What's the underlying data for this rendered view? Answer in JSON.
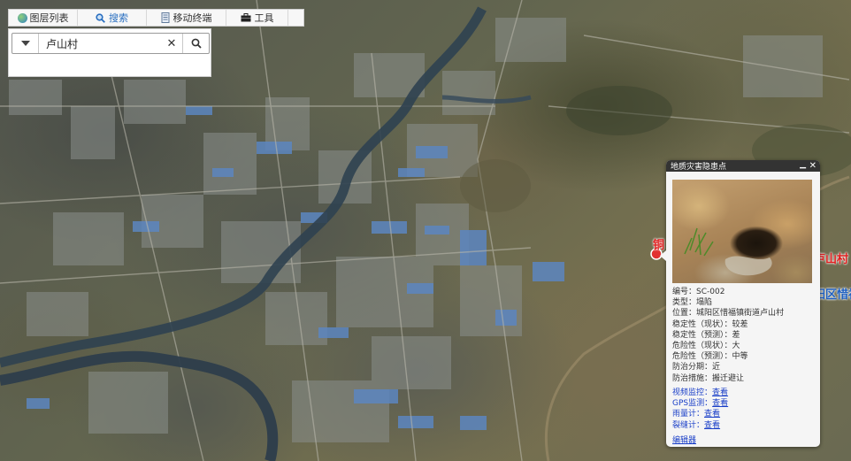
{
  "toolbar": {
    "items": [
      {
        "label": "图层列表",
        "icon": "layers-icon",
        "color": "#3a8a3a"
      },
      {
        "label": "搜索",
        "icon": "search-icon",
        "color": "#2a6fc0"
      },
      {
        "label": "移动终端",
        "icon": "mobile-doc-icon",
        "color": "#555555"
      },
      {
        "label": "工具",
        "icon": "toolbox-icon",
        "color": "#222222"
      }
    ]
  },
  "search": {
    "value": "卢山村",
    "clear_glyph": "✕",
    "search_glyph": "⌕"
  },
  "popup": {
    "title": "地质灾害隐患点",
    "minimize_glyph": "▁",
    "close_glyph": "✕",
    "photo_icon": "cave-photo",
    "fields": [
      {
        "label": "编号",
        "value": "SC-002"
      },
      {
        "label": "类型",
        "value": "塌陷"
      },
      {
        "label": "位置",
        "value": "城阳区惜福镇街道卢山村"
      },
      {
        "label": "稳定性（现状）",
        "value": "较差"
      },
      {
        "label": "稳定性（预测）",
        "value": "差"
      },
      {
        "label": "危险性（现状）",
        "value": "大"
      },
      {
        "label": "危险性（预测）",
        "value": "中等"
      },
      {
        "label": "防治分期",
        "value": "近"
      },
      {
        "label": "防治措施",
        "value": "搬迁避让"
      }
    ],
    "links": [
      {
        "label": "视频监控",
        "value": "查看"
      },
      {
        "label": "GPS监测",
        "value": "查看"
      },
      {
        "label": "雨量计",
        "value": "查看"
      },
      {
        "label": "裂缝计",
        "value": "查看"
      }
    ],
    "edit_label": "编辑器",
    "link_color": "#1a3fc8"
  },
  "map_labels": [
    {
      "text": "铜",
      "color": "#e02020"
    },
    {
      "text": "卢山村",
      "color": "#e02020"
    },
    {
      "text": "阳区惜福",
      "color": "#2060c0"
    }
  ]
}
